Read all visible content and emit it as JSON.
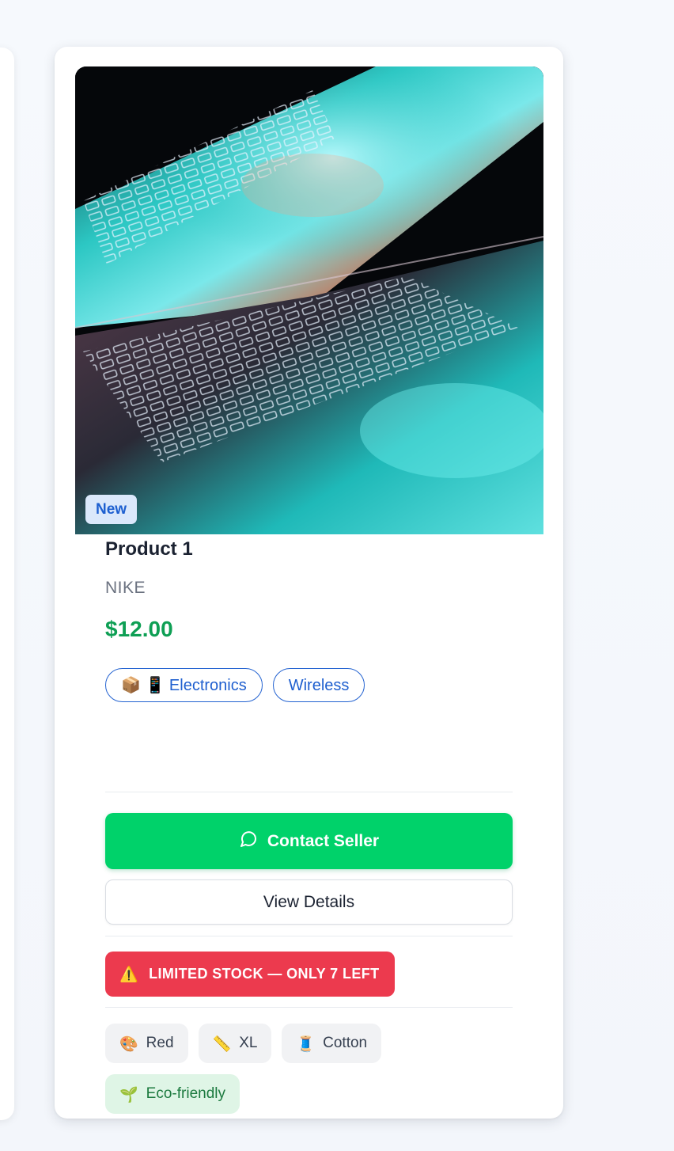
{
  "product": {
    "badge": "New",
    "title": "Product 1",
    "brand": "NIKE",
    "price": "$12.00",
    "image_alt": "laptop-photo",
    "tags": [
      {
        "label": "📦 📱 Electronics"
      },
      {
        "label": "Wireless"
      }
    ],
    "actions": {
      "contact_label": "Contact Seller",
      "contact_icon": "chat-bubble-icon",
      "details_label": "View Details"
    },
    "stock_alert": {
      "icon": "⚠️",
      "text": "LIMITED STOCK — ONLY 7 LEFT"
    },
    "attributes": [
      {
        "icon": "🎨",
        "label": "Red"
      },
      {
        "icon": "📏",
        "label": "XL"
      },
      {
        "icon": "🧵",
        "label": "Cotton"
      },
      {
        "icon": "🌱",
        "label": "Eco-friendly"
      }
    ]
  },
  "colors": {
    "accent_green": "#00d26a",
    "price_green": "#0e9f54",
    "tag_blue": "#1f5fcf",
    "alert_red": "#ec3a4e",
    "eco_bg": "#dff5e6"
  }
}
